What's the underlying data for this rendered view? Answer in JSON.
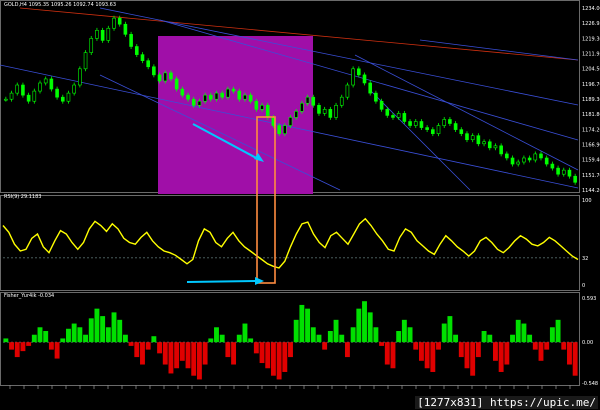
{
  "colors": {
    "background": "#000000",
    "candle": "#00ff00",
    "highlight_box": "#a00fa8",
    "rsi_line": "#ffff00",
    "fisher_pos": "#00e000",
    "fisher_neg": "#e00000",
    "trendline_blue": "#3a4fd8",
    "trendline_red": "#d03010",
    "arrow": "#00c8ff",
    "orange_box": "#ff8c40",
    "grid": "#556b6b"
  },
  "price_pane": {
    "label": "GOLD,H4  1095.35 1095.26 1092.74 1093.63",
    "y_ticks": [
      "1234.00",
      "1226.93",
      "1219.30",
      "1211.95",
      "1204.50",
      "1196.70",
      "1189.30",
      "1181.80",
      "1174.20",
      "1166.90",
      "1159.40",
      "1151.70",
      "1144.20"
    ]
  },
  "rsi_pane": {
    "label": "RSI(9) 29.1183",
    "y_ticks": [
      "100",
      "32",
      "0"
    ]
  },
  "fisher_pane": {
    "label": "Fisher_Yur4ik -0.034",
    "y_ticks": [
      "0.593",
      "0.00",
      "-0.548"
    ]
  },
  "watermark": "[1277x831] https://upic.me/",
  "chart_data": [
    {
      "type": "candlestick",
      "y_ticks": [
        "1234.00",
        "1226.93",
        "1219.30",
        "1211.95",
        "1204.50",
        "1196.70",
        "1189.30",
        "1181.80",
        "1174.20",
        "1166.90",
        "1159.40",
        "1151.70",
        "1144.20"
      ],
      "ylim": [
        1144.2,
        1234.0
      ],
      "close_series": [
        1189,
        1192,
        1196,
        1191,
        1188,
        1193,
        1197,
        1199,
        1194,
        1190,
        1188,
        1192,
        1196,
        1204,
        1212,
        1219,
        1223,
        1218,
        1224,
        1229,
        1226,
        1221,
        1215,
        1211,
        1208,
        1205,
        1201,
        1198,
        1202,
        1199,
        1194,
        1191,
        1189,
        1186,
        1188,
        1191,
        1189,
        1192,
        1190,
        1194,
        1193,
        1189,
        1191,
        1188,
        1184,
        1186,
        1180,
        1176,
        1172,
        1176,
        1180,
        1183,
        1187,
        1190,
        1186,
        1182,
        1184,
        1180,
        1186,
        1190,
        1196,
        1204,
        1201,
        1197,
        1192,
        1188,
        1184,
        1181,
        1180,
        1182,
        1178,
        1176,
        1178,
        1175,
        1174,
        1172,
        1176,
        1179,
        1177,
        1174,
        1172,
        1169,
        1171,
        1167,
        1168,
        1165,
        1166,
        1162,
        1160,
        1157,
        1158,
        1160,
        1159,
        1162,
        1160,
        1157,
        1155,
        1152,
        1154,
        1151,
        1148
      ]
    },
    {
      "type": "line",
      "name": "RSI(9)",
      "y_ticks": [
        "100",
        "32",
        "0"
      ],
      "ylim": [
        0,
        100
      ],
      "values": [
        70,
        62,
        48,
        40,
        42,
        55,
        60,
        45,
        38,
        52,
        64,
        60,
        50,
        42,
        50,
        66,
        75,
        70,
        63,
        72,
        66,
        55,
        50,
        48,
        56,
        62,
        52,
        45,
        40,
        38,
        35,
        30,
        25,
        30,
        52,
        66,
        62,
        50,
        45,
        55,
        62,
        52,
        45,
        40,
        35,
        30,
        25,
        22,
        20,
        28,
        45,
        60,
        72,
        74,
        60,
        50,
        44,
        58,
        62,
        55,
        48,
        60,
        72,
        78,
        70,
        60,
        52,
        42,
        40,
        56,
        66,
        62,
        52,
        46,
        40,
        36,
        48,
        58,
        52,
        45,
        40,
        34,
        40,
        52,
        56,
        50,
        42,
        38,
        44,
        52,
        58,
        54,
        48,
        46,
        50,
        56,
        52,
        46,
        40,
        34,
        30
      ]
    },
    {
      "type": "bar",
      "name": "Fisher_Yur4ik",
      "y_ticks": [
        "0.593",
        "0.00",
        "-0.548"
      ],
      "ylim": [
        -0.548,
        0.593
      ],
      "values": [
        0.05,
        -0.1,
        -0.2,
        -0.12,
        -0.05,
        0.1,
        0.2,
        0.15,
        -0.1,
        -0.22,
        0.05,
        0.18,
        0.25,
        0.2,
        0.1,
        0.32,
        0.45,
        0.35,
        0.2,
        0.4,
        0.3,
        0.1,
        -0.05,
        -0.2,
        -0.3,
        -0.1,
        0.08,
        -0.15,
        -0.3,
        -0.42,
        -0.35,
        -0.25,
        -0.35,
        -0.45,
        -0.5,
        -0.3,
        0.05,
        0.2,
        0.1,
        -0.2,
        -0.3,
        0.1,
        0.25,
        0.05,
        -0.15,
        -0.28,
        -0.35,
        -0.45,
        -0.5,
        -0.4,
        -0.2,
        0.3,
        0.5,
        0.45,
        0.2,
        0.1,
        -0.1,
        0.15,
        0.3,
        0.1,
        -0.2,
        0.2,
        0.45,
        0.55,
        0.4,
        0.2,
        -0.05,
        -0.3,
        -0.35,
        0.15,
        0.3,
        0.2,
        -0.1,
        -0.25,
        -0.35,
        -0.4,
        -0.1,
        0.25,
        0.35,
        0.1,
        -0.2,
        -0.35,
        -0.45,
        -0.2,
        0.15,
        0.1,
        -0.25,
        -0.4,
        -0.3,
        0.1,
        0.3,
        0.25,
        0.1,
        -0.1,
        -0.25,
        -0.1,
        0.2,
        0.3,
        -0.1,
        -0.3,
        -0.45
      ]
    }
  ]
}
